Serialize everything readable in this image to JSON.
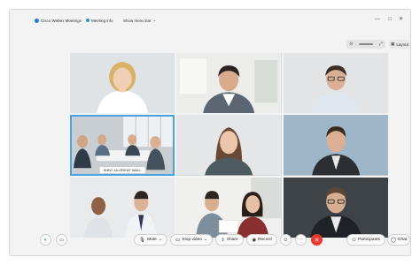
{
  "titlebar": {
    "app_title": "Cisco Webex Meetings",
    "meeting_info": "Meeting info",
    "show_menu_bar": "Show menu bar",
    "chevron": "⌄",
    "minimize": "—",
    "maximize": "□",
    "close": "✕"
  },
  "view": {
    "layout_label": "Layout"
  },
  "tiles": [
    {
      "label": ""
    },
    {
      "label": ""
    },
    {
      "label": ""
    },
    {
      "label": "5HN7-16-GREAT WALL"
    },
    {
      "label": ""
    },
    {
      "label": ""
    },
    {
      "label": ""
    },
    {
      "label": ""
    },
    {
      "label": ""
    }
  ],
  "controls": {
    "mute_label": "Mute",
    "stop_video_label": "Stop video",
    "share_label": "Share",
    "record_label": "Record",
    "participants_label": "Participants",
    "chat_label": "Chat",
    "chevron": "⌄",
    "more": "···",
    "end_icon": "✕"
  },
  "colors": {
    "end_call": "#e8392e",
    "active_speaker": "#4aa3df",
    "webex_blue": "#1f7ed0"
  }
}
